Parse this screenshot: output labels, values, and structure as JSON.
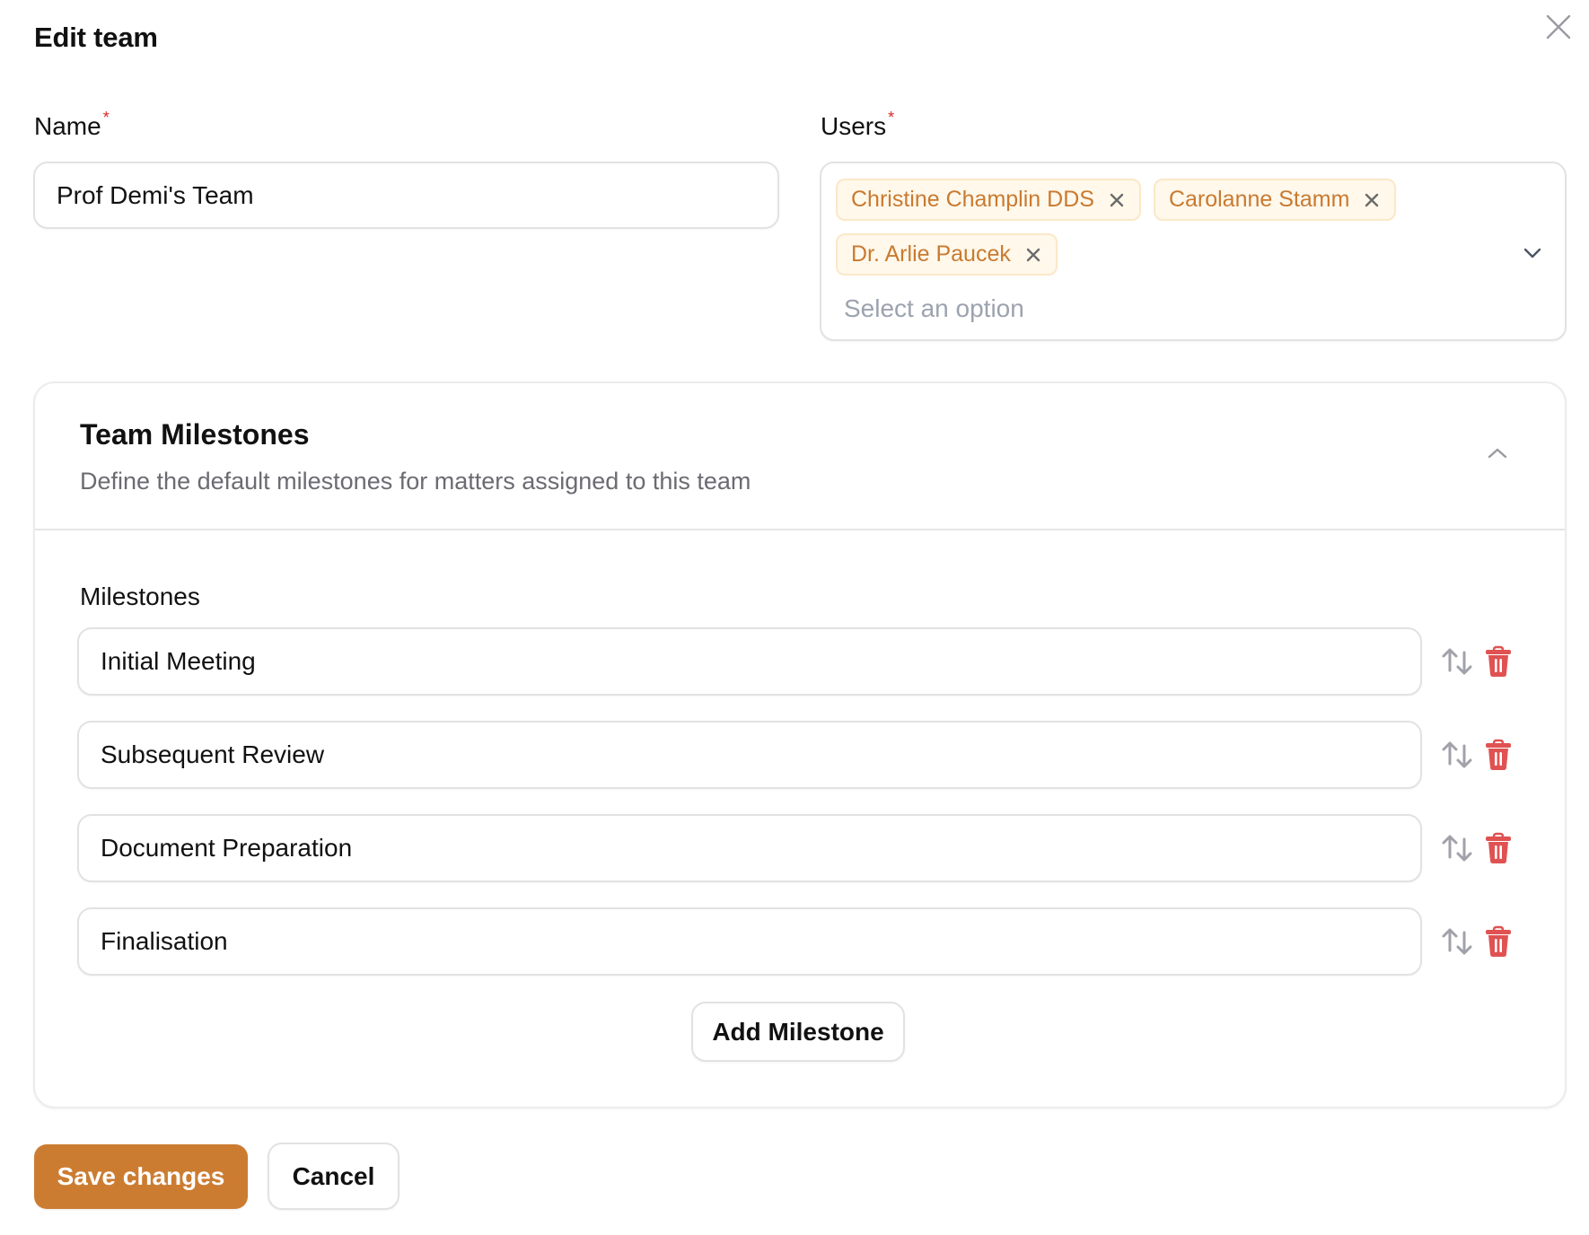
{
  "dialog": {
    "title": "Edit team",
    "close_icon": "close-icon"
  },
  "form": {
    "name": {
      "label": "Name",
      "required_mark": "*",
      "value": "Prof Demi's Team"
    },
    "users": {
      "label": "Users",
      "required_mark": "*",
      "selected": [
        {
          "name": "Christine Champlin DDS",
          "remove_icon": "x-icon"
        },
        {
          "name": "Carolanne Stamm",
          "remove_icon": "x-icon"
        },
        {
          "name": "Dr. Arlie Paucek",
          "remove_icon": "x-icon"
        }
      ],
      "placeholder": "Select an option",
      "dropdown_icon": "chevron-down-icon"
    }
  },
  "milestones_section": {
    "title": "Team Milestones",
    "subtitle": "Define the default milestones for matters assigned to this team",
    "collapse_icon": "chevron-up-icon",
    "list_label": "Milestones",
    "items": [
      {
        "value": "Initial Meeting"
      },
      {
        "value": "Subsequent Review"
      },
      {
        "value": "Document Preparation"
      },
      {
        "value": "Finalisation"
      }
    ],
    "row_icons": {
      "reorder": "arrows-up-down-icon",
      "delete": "trash-icon"
    },
    "add_label": "Add Milestone"
  },
  "footer": {
    "save_label": "Save changes",
    "cancel_label": "Cancel"
  },
  "colors": {
    "accent": "#cc7c31",
    "chip_bg": "#fff8eb",
    "chip_border": "#fbe8c8",
    "chip_text": "#c97a30",
    "danger": "#e05252",
    "required": "#dc2626"
  }
}
